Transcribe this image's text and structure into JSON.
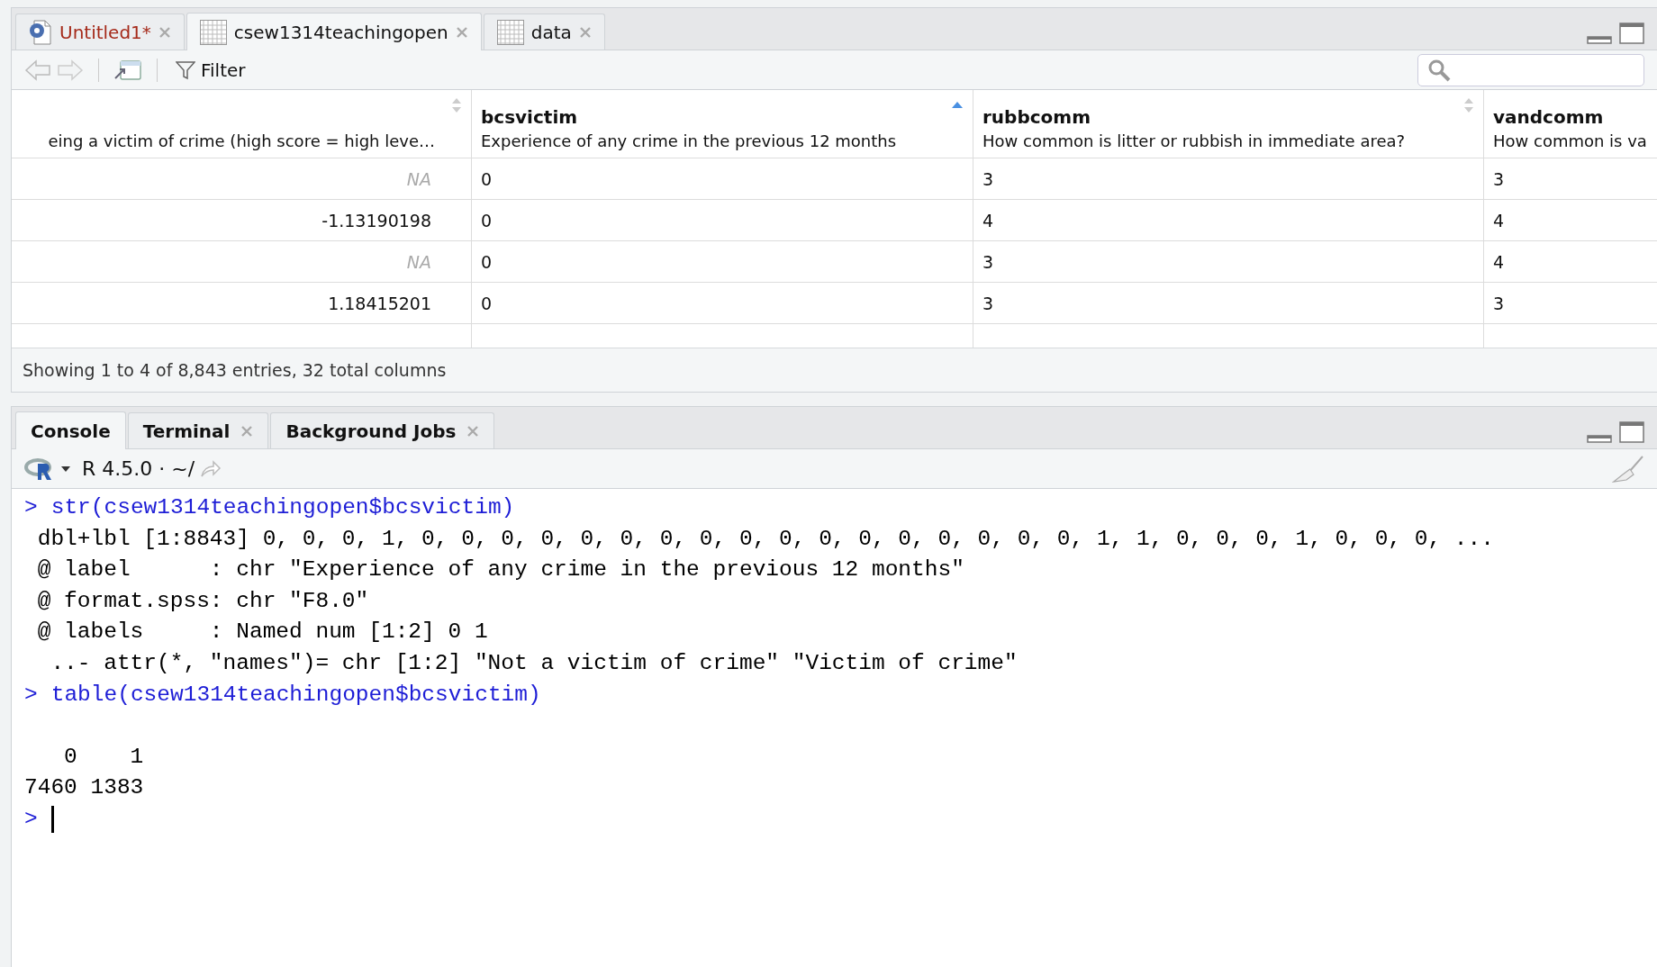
{
  "source_tabs": [
    {
      "label": "Untitled1*",
      "kind": "script",
      "selected": false,
      "modified": true
    },
    {
      "label": "csew1314teachingopen",
      "kind": "data",
      "selected": true,
      "modified": false
    },
    {
      "label": "data",
      "kind": "data",
      "selected": false,
      "modified": false
    }
  ],
  "data_toolbar": {
    "back_disabled": true,
    "forward_disabled": true,
    "filter_label": "Filter"
  },
  "table": {
    "columns": [
      {
        "label": "eing a victim of crime (high score = high leve…",
        "sorted_ascending": false,
        "numeric": true
      },
      {
        "name": "bcsvictim",
        "label": "Experience of any crime in the previous 12 months",
        "sorted_ascending": true,
        "numeric": false
      },
      {
        "name": "rubbcomm",
        "label": "How common is litter or rubbish in immediate area?",
        "sorted_ascending": false,
        "numeric": false
      },
      {
        "name": "vandcomm",
        "label": "How common is va",
        "numeric": false
      }
    ],
    "rows": [
      {
        "cells": [
          {
            "text": "NA",
            "na": true
          },
          {
            "text": "0",
            "na": false
          },
          {
            "text": "3",
            "na": false
          },
          {
            "text": "3",
            "na": false
          }
        ]
      },
      {
        "cells": [
          {
            "text": "-1.13190198",
            "na": false
          },
          {
            "text": "0",
            "na": false
          },
          {
            "text": "4",
            "na": false
          },
          {
            "text": "4",
            "na": false
          }
        ]
      },
      {
        "cells": [
          {
            "text": "NA",
            "na": true
          },
          {
            "text": "0",
            "na": false
          },
          {
            "text": "3",
            "na": false
          },
          {
            "text": "4",
            "na": false
          }
        ]
      },
      {
        "cells": [
          {
            "text": "1.18415201",
            "na": false
          },
          {
            "text": "0",
            "na": false
          },
          {
            "text": "3",
            "na": false
          },
          {
            "text": "3",
            "na": false
          }
        ]
      }
    ],
    "status": "Showing 1 to 4 of 8,843 entries, 32 total columns"
  },
  "console_tabs": [
    {
      "label": "Console",
      "selected": true,
      "closable": false
    },
    {
      "label": "Terminal",
      "selected": false,
      "closable": true
    },
    {
      "label": "Background Jobs",
      "selected": false,
      "closable": true
    }
  ],
  "console_toolbar": {
    "version": "R 4.5.0 · ~/"
  },
  "console": [
    {
      "kind": "input",
      "prompt": ">",
      "text": "str(csew1314teachingopen$bcsvictim)"
    },
    {
      "kind": "output",
      "text": " dbl+lbl [1:8843] 0, 0, 0, 1, 0, 0, 0, 0, 0, 0, 0, 0, 0, 0, 0, 0, 0, 0, 0, 0, 0, 1, 1, 0, 0, 0, 1, 0, 0, 0, ..."
    },
    {
      "kind": "output",
      "text": " @ label      : chr \"Experience of any crime in the previous 12 months\""
    },
    {
      "kind": "output",
      "text": " @ format.spss: chr \"F8.0\""
    },
    {
      "kind": "output",
      "text": " @ labels     : Named num [1:2] 0 1"
    },
    {
      "kind": "output",
      "text": "  ..- attr(*, \"names\")= chr [1:2] \"Not a victim of crime\" \"Victim of crime\""
    },
    {
      "kind": "input",
      "prompt": ">",
      "text": "table(csew1314teachingopen$bcsvictim)"
    },
    {
      "kind": "blank"
    },
    {
      "kind": "output",
      "text": "   0    1"
    },
    {
      "kind": "output",
      "text": "7460 1383"
    },
    {
      "kind": "cursor",
      "prompt": ">"
    }
  ]
}
